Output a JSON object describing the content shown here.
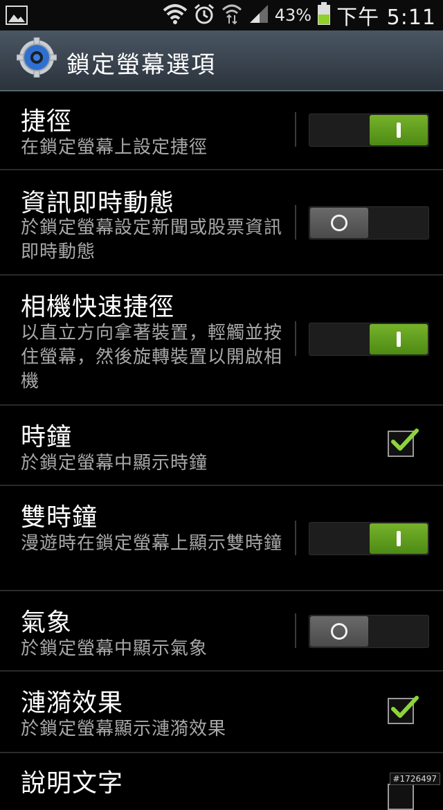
{
  "status_bar": {
    "battery_percent": "43%",
    "time": "下午 5:11"
  },
  "header": {
    "title": "鎖定螢幕選項"
  },
  "settings": [
    {
      "title": "捷徑",
      "summary": "在鎖定螢幕上設定捷徑",
      "control": "toggle",
      "enabled": true
    },
    {
      "title": "資訊即時動態",
      "summary": "於鎖定螢幕設定新聞或股票資訊即時動態",
      "control": "toggle",
      "enabled": false
    },
    {
      "title": "相機快速捷徑",
      "summary": "以直立方向拿著裝置，輕觸並按住螢幕，然後旋轉裝置以開啟相機",
      "control": "toggle",
      "enabled": true
    },
    {
      "title": "時鐘",
      "summary": "於鎖定螢幕中顯示時鐘",
      "control": "checkbox",
      "enabled": true
    },
    {
      "title": "雙時鐘",
      "summary": "漫遊時在鎖定螢幕上顯示雙時鐘",
      "control": "toggle",
      "enabled": true
    },
    {
      "title": "氣象",
      "summary": "於鎖定螢幕中顯示氣象",
      "control": "toggle",
      "enabled": false
    },
    {
      "title": "漣漪效果",
      "summary": "於鎖定螢幕顯示漣漪效果",
      "control": "checkbox",
      "enabled": true
    },
    {
      "title": "說明文字",
      "summary": "",
      "control": "checkbox",
      "enabled": false
    }
  ],
  "watermark": "#1726497",
  "colors": {
    "accent_green": "#6aa823",
    "title_bar": "#3a444e"
  }
}
